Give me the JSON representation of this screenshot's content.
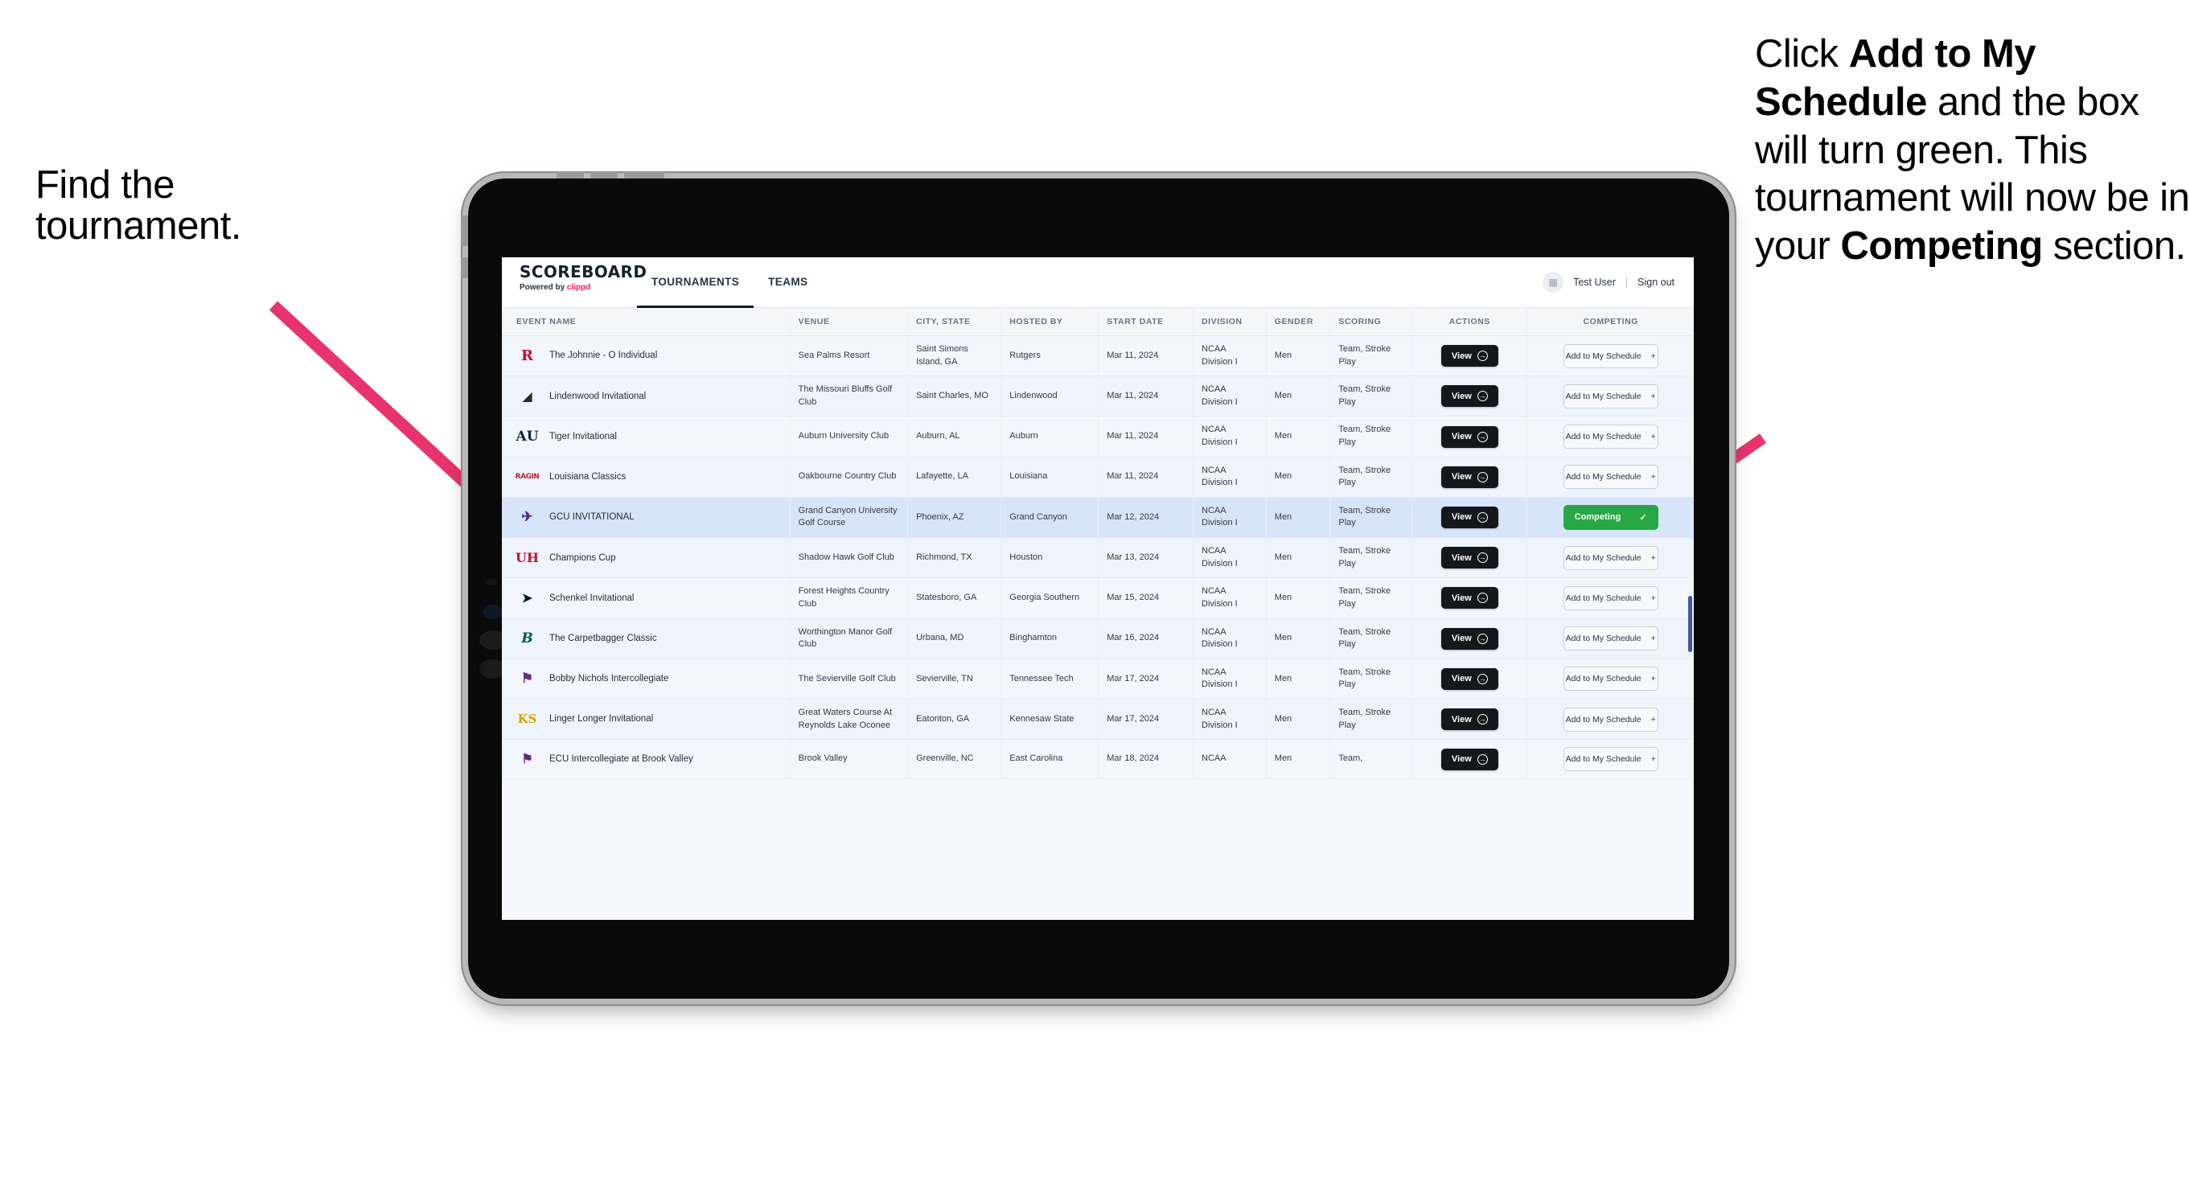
{
  "annotations": {
    "left": "Find the tournament.",
    "right_parts": [
      {
        "text": "Click ",
        "bold": false
      },
      {
        "text": "Add to My Schedule",
        "bold": true
      },
      {
        "text": " and the box will turn green. This tournament will now be in your ",
        "bold": false
      },
      {
        "text": "Competing",
        "bold": true
      },
      {
        "text": " section.",
        "bold": false
      }
    ],
    "arrow_color": "#e8336d"
  },
  "app": {
    "brand": {
      "title": "SCOREBOARD",
      "powered_prefix": "Powered by ",
      "powered_brand": "clippd"
    },
    "nav": [
      {
        "label": "TOURNAMENTS",
        "active": true
      },
      {
        "label": "TEAMS",
        "active": false
      }
    ],
    "user": {
      "avatar_glyph": "▦",
      "name": "Test User",
      "separator": "|",
      "sign_out": "Sign out"
    },
    "table": {
      "columns": [
        "EVENT NAME",
        "VENUE",
        "CITY, STATE",
        "HOSTED BY",
        "START DATE",
        "DIVISION",
        "GENDER",
        "SCORING",
        "ACTIONS",
        "COMPETING"
      ],
      "view_label": "View",
      "add_label": "Add to My Schedule",
      "add_glyph": "+",
      "competing_label": "Competing",
      "competing_glyph": "✓",
      "competing_color": "#27a844",
      "rows": [
        {
          "logo": "R",
          "logo_class": "logo-rutgers",
          "event": "The Johnnie - O Individual",
          "venue": "Sea Palms Resort",
          "city": "Saint Simons Island, GA",
          "host": "Rutgers",
          "date": "Mar 11, 2024",
          "division": "NCAA Division I",
          "gender": "Men",
          "scoring": "Team, Stroke Play",
          "competing": false
        },
        {
          "logo": "◢",
          "logo_class": "logo-lindenwood",
          "event": "Lindenwood Invitational",
          "venue": "The Missouri Bluffs Golf Club",
          "city": "Saint Charles, MO",
          "host": "Lindenwood",
          "date": "Mar 11, 2024",
          "division": "NCAA Division I",
          "gender": "Men",
          "scoring": "Team, Stroke Play",
          "competing": false
        },
        {
          "logo": "AU",
          "logo_class": "logo-auburn",
          "event": "Tiger Invitational",
          "venue": "Auburn University Club",
          "city": "Auburn, AL",
          "host": "Auburn",
          "date": "Mar 11, 2024",
          "division": "NCAA Division I",
          "gender": "Men",
          "scoring": "Team, Stroke Play",
          "competing": false
        },
        {
          "logo": "RAGIN",
          "logo_class": "logo-louisiana",
          "event": "Louisiana Classics",
          "venue": "Oakbourne Country Club",
          "city": "Lafayette, LA",
          "host": "Louisiana",
          "date": "Mar 11, 2024",
          "division": "NCAA Division I",
          "gender": "Men",
          "scoring": "Team, Stroke Play",
          "competing": false
        },
        {
          "logo": "✈",
          "logo_class": "logo-gcu",
          "event": "GCU INVITATIONAL",
          "venue": "Grand Canyon University Golf Course",
          "city": "Phoenix, AZ",
          "host": "Grand Canyon",
          "date": "Mar 12, 2024",
          "division": "NCAA Division I",
          "gender": "Men",
          "scoring": "Team, Stroke Play",
          "competing": true
        },
        {
          "logo": "UH",
          "logo_class": "logo-houston",
          "event": "Champions Cup",
          "venue": "Shadow Hawk Golf Club",
          "city": "Richmond, TX",
          "host": "Houston",
          "date": "Mar 13, 2024",
          "division": "NCAA Division I",
          "gender": "Men",
          "scoring": "Team, Stroke Play",
          "competing": false
        },
        {
          "logo": "➤",
          "logo_class": "logo-gasouthern",
          "event": "Schenkel Invitational",
          "venue": "Forest Heights Country Club",
          "city": "Statesboro, GA",
          "host": "Georgia Southern",
          "date": "Mar 15, 2024",
          "division": "NCAA Division I",
          "gender": "Men",
          "scoring": "Team, Stroke Play",
          "competing": false
        },
        {
          "logo": "B",
          "logo_class": "logo-binghamton",
          "event": "The Carpetbagger Classic",
          "venue": "Worthington Manor Golf Club",
          "city": "Urbana, MD",
          "host": "Binghamton",
          "date": "Mar 16, 2024",
          "division": "NCAA Division I",
          "gender": "Men",
          "scoring": "Team, Stroke Play",
          "competing": false
        },
        {
          "logo": "⚑",
          "logo_class": "logo-tntech",
          "event": "Bobby Nichols Intercollegiate",
          "venue": "The Sevierville Golf Club",
          "city": "Sevierville, TN",
          "host": "Tennessee Tech",
          "date": "Mar 17, 2024",
          "division": "NCAA Division I",
          "gender": "Men",
          "scoring": "Team, Stroke Play",
          "competing": false
        },
        {
          "logo": "KS",
          "logo_class": "logo-kennesaw",
          "event": "Linger Longer Invitational",
          "venue": "Great Waters Course At Reynolds Lake Oconee",
          "city": "Eatonton, GA",
          "host": "Kennesaw State",
          "date": "Mar 17, 2024",
          "division": "NCAA Division I",
          "gender": "Men",
          "scoring": "Team, Stroke Play",
          "competing": false
        },
        {
          "logo": "⚑",
          "logo_class": "logo-ecu",
          "event": "ECU Intercollegiate at Brook Valley",
          "venue": "Brook Valley",
          "city": "Greenville, NC",
          "host": "East Carolina",
          "date": "Mar 18, 2024",
          "division": "NCAA",
          "gender": "Men",
          "scoring": "Team,",
          "competing": false
        }
      ]
    }
  }
}
